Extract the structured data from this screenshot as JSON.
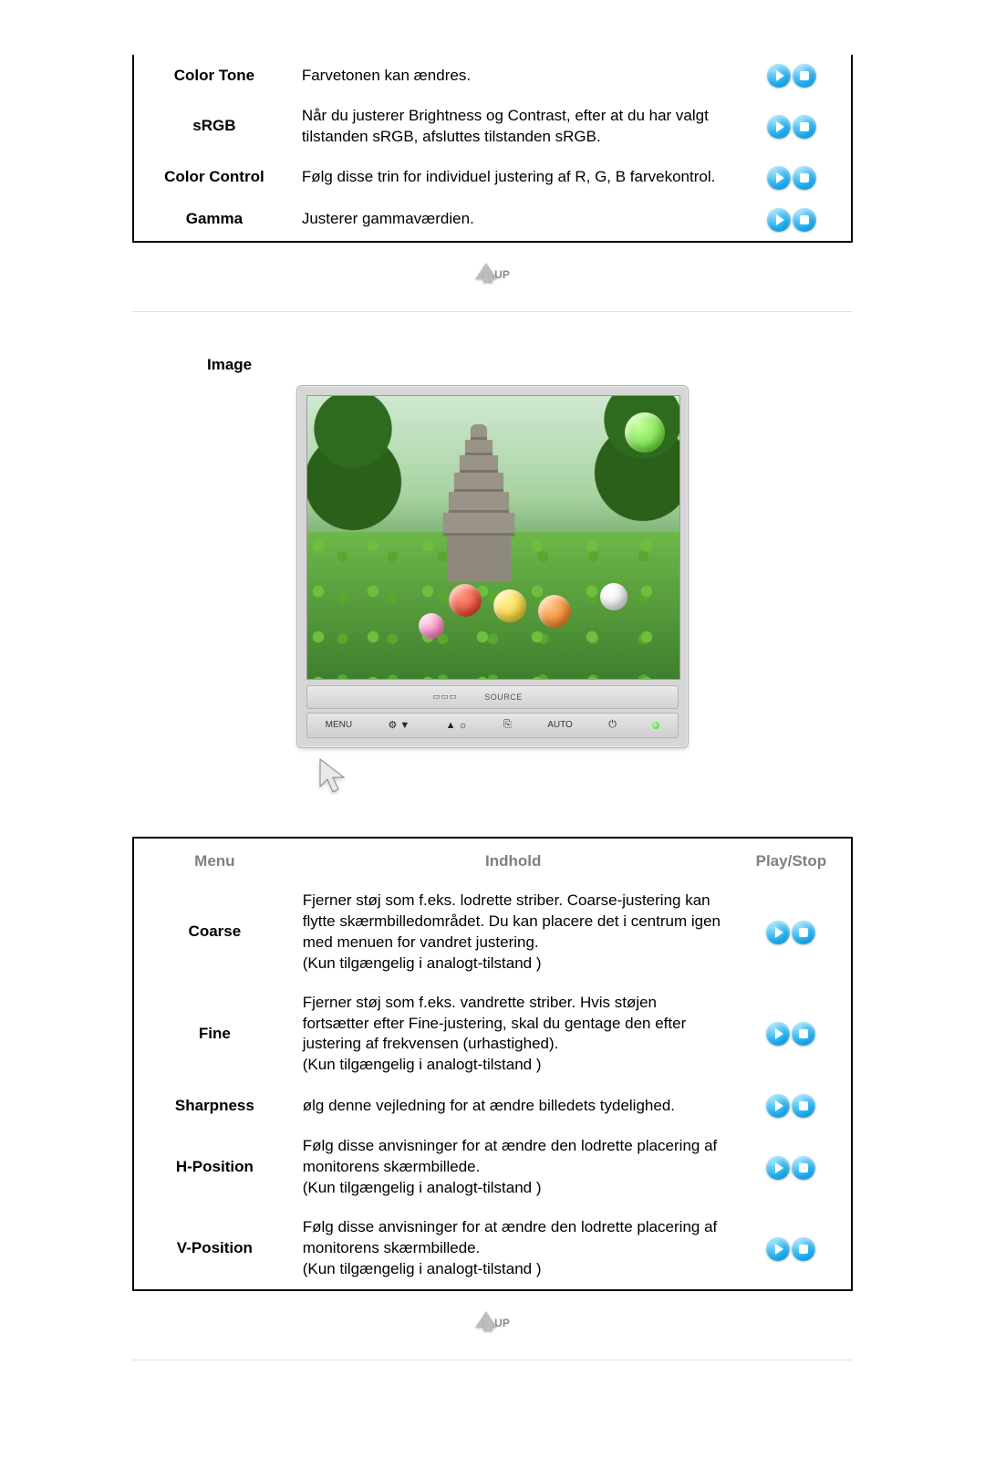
{
  "table1": {
    "rows": [
      {
        "menu": "Color Tone",
        "content": "Farvetonen kan ændres."
      },
      {
        "menu": "sRGB",
        "content": "Når du justerer Brightness og Contrast, efter at du har valgt tilstanden sRGB, afsluttes tilstanden sRGB."
      },
      {
        "menu": "Color Control",
        "content": "Følg disse trin for individuel justering af R, G, B farvekontrol."
      },
      {
        "menu": "Gamma",
        "content": "Justerer gammaværdien."
      }
    ]
  },
  "up_label": "UP",
  "section2_title": "Image",
  "monitor": {
    "front_panel": {
      "left_logo": "",
      "source": "SOURCE"
    },
    "buttons": {
      "menu": "MENU",
      "sym1": "⚙ ▼",
      "sym2": "▲ ☼",
      "src": "⎘",
      "auto": "AUTO",
      "power": "⏻"
    }
  },
  "table2": {
    "headers": {
      "menu": "Menu",
      "content": "Indhold",
      "ps": "Play/Stop"
    },
    "rows": [
      {
        "menu": "Coarse",
        "content": "Fjerner støj som f.eks. lodrette striber. Coarse-justering kan flytte skærmbilledområdet. Du kan placere det i centrum igen med menuen for vandret justering.\n(Kun tilgængelig i analogt-tilstand )"
      },
      {
        "menu": "Fine",
        "content": "Fjerner støj som f.eks. vandrette striber. Hvis støjen fortsætter efter Fine-justering, skal du gentage den efter justering af frekvensen (urhastighed).\n(Kun tilgængelig i analogt-tilstand )"
      },
      {
        "menu": "Sharpness",
        "content": "ølg denne vejledning for at ændre billedets tydelighed."
      },
      {
        "menu": "H-Position",
        "content": "Følg disse anvisninger for at ændre den lodrette placering af monitorens skærmbillede.\n(Kun tilgængelig i analogt-tilstand )"
      },
      {
        "menu": "V-Position",
        "content": "Følg disse anvisninger for at ændre den lodrette placering af monitorens skærmbillede.\n(Kun tilgængelig i analogt-tilstand )"
      }
    ]
  }
}
